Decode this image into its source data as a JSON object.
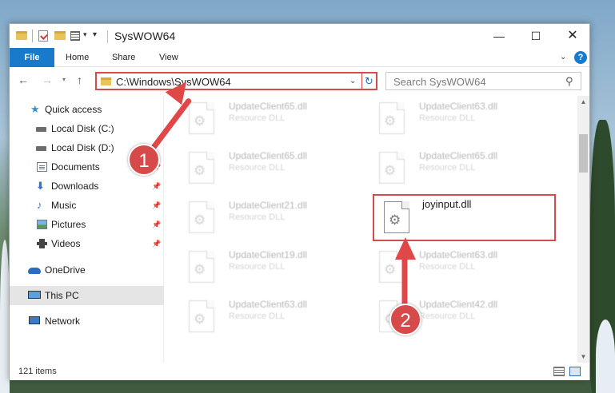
{
  "window": {
    "title": "SysWOW64"
  },
  "ribbon": {
    "tabs": [
      "File",
      "Home",
      "Share",
      "View"
    ],
    "help": "?"
  },
  "address": {
    "path": "C:\\Windows\\SysWOW64"
  },
  "search": {
    "placeholder": "Search SysWOW64"
  },
  "sidebar": {
    "items": [
      {
        "label": "Quick access",
        "icon": "star-icon"
      },
      {
        "label": "Local Disk (C:)",
        "icon": "drive-icon"
      },
      {
        "label": "Local Disk (D:)",
        "icon": "drive-icon"
      },
      {
        "label": "Documents",
        "icon": "documents-icon"
      },
      {
        "label": "Downloads",
        "icon": "downloads-icon"
      },
      {
        "label": "Music",
        "icon": "music-icon"
      },
      {
        "label": "Pictures",
        "icon": "pictures-icon"
      },
      {
        "label": "Videos",
        "icon": "videos-icon"
      },
      {
        "label": "OneDrive",
        "icon": "onedrive-icon"
      },
      {
        "label": "This PC",
        "icon": "pc-icon"
      },
      {
        "label": "Network",
        "icon": "network-icon"
      }
    ]
  },
  "files": [
    {
      "name": "UpdateClient65.dll",
      "type": "Resource DLL"
    },
    {
      "name": "UpdateClient63.dll",
      "type": "Resource DLL"
    },
    {
      "name": "UpdateClient65.dll",
      "type": "Resource DLL"
    },
    {
      "name": "UpdateClient65.dll",
      "type": "Resource DLL"
    },
    {
      "name": "UpdateClient21.dll",
      "type": "Resource DLL"
    },
    {
      "name": "joyinput.dll",
      "type": ""
    },
    {
      "name": "UpdateClient19.dll",
      "type": "Resource DLL"
    },
    {
      "name": "UpdateClient63.dll",
      "type": "Resource DLL"
    },
    {
      "name": "UpdateClient63.dll",
      "type": "Resource DLL"
    },
    {
      "name": "UpdateClient42.dll",
      "type": "Resource DLL"
    }
  ],
  "status": {
    "count": "121 items"
  },
  "annotations": {
    "step1": "1",
    "step2": "2",
    "color": "#d64a4a"
  }
}
